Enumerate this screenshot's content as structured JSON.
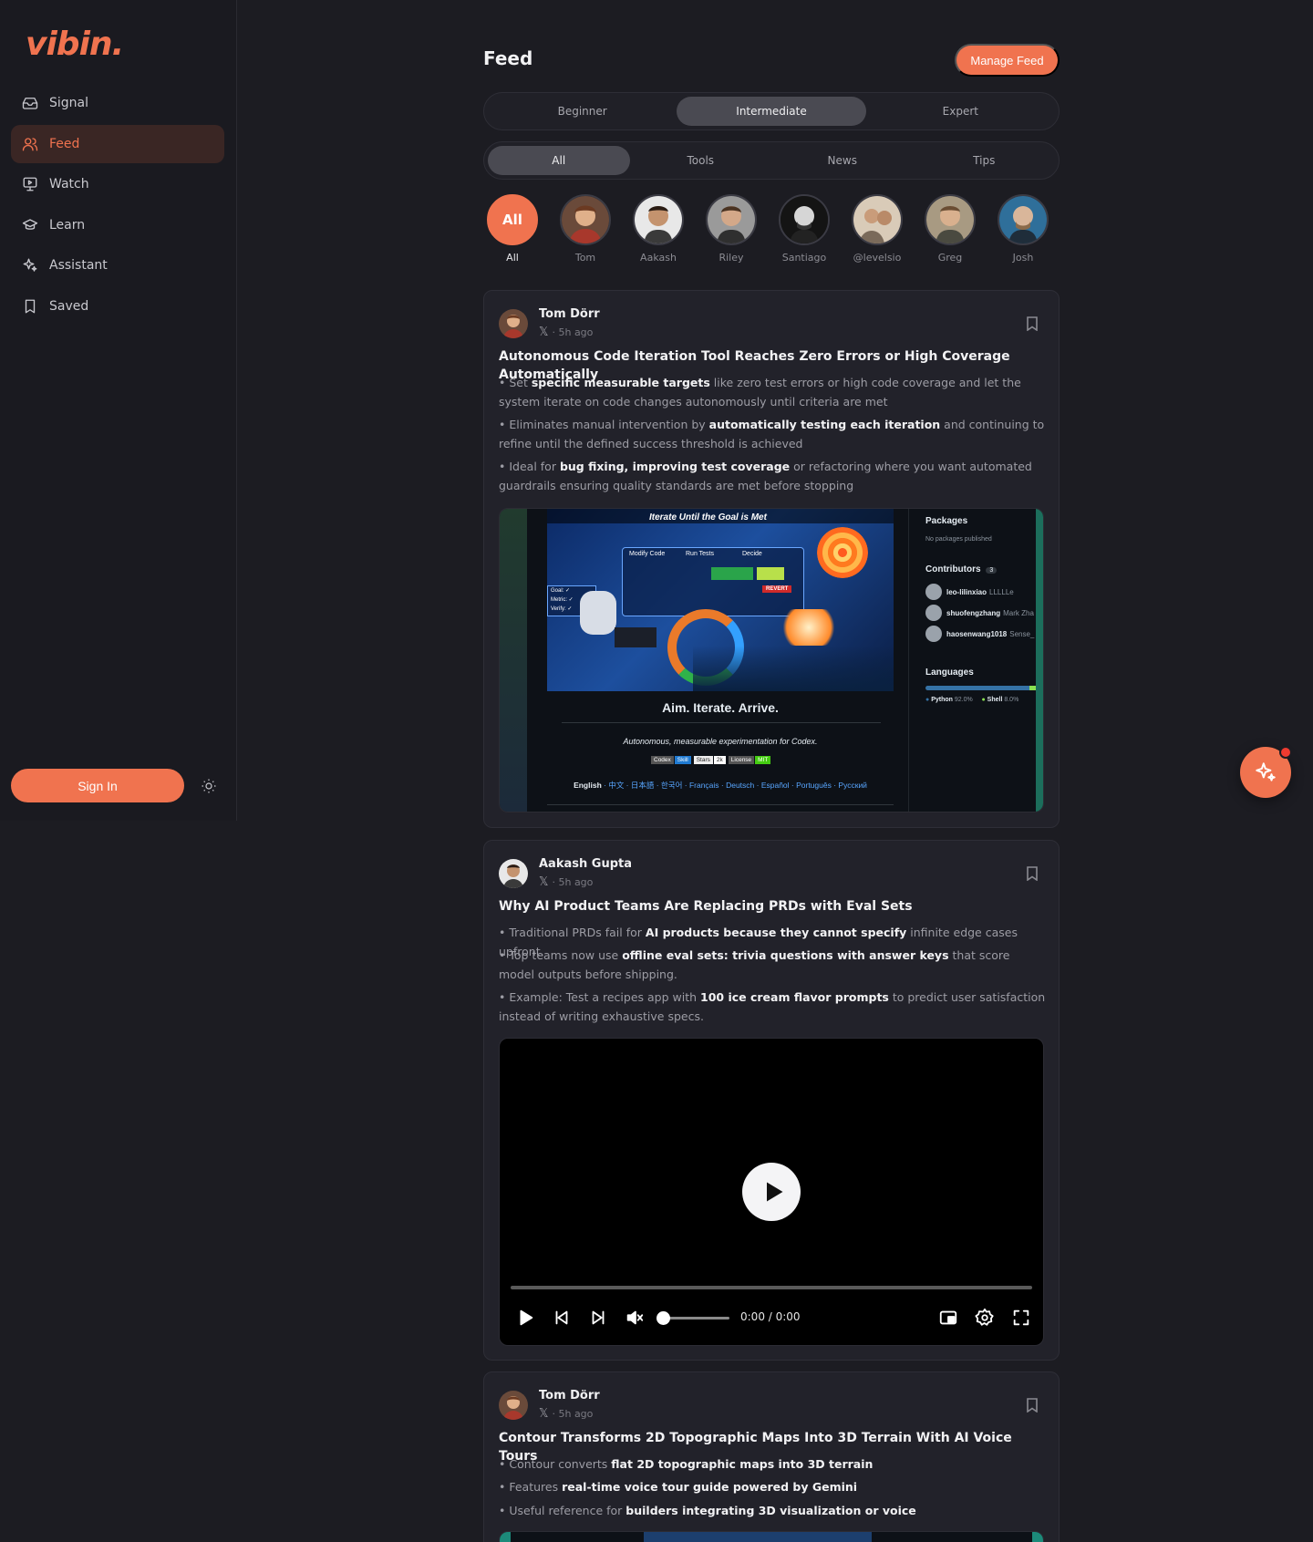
{
  "app": {
    "logo": "vibin."
  },
  "sidebar": {
    "items": [
      {
        "label": "Signal",
        "icon": "inbox-icon"
      },
      {
        "label": "Feed",
        "icon": "users-icon",
        "active": true
      },
      {
        "label": "Watch",
        "icon": "monitor-play-icon"
      },
      {
        "label": "Learn",
        "icon": "graduation-cap-icon"
      },
      {
        "label": "Assistant",
        "icon": "sparkles-icon"
      },
      {
        "label": "Saved",
        "icon": "bookmark-icon"
      }
    ],
    "signin_label": "Sign In",
    "theme_icon": "sun-icon"
  },
  "header": {
    "title": "Feed",
    "manage_label": "Manage Feed"
  },
  "levels": {
    "options": [
      "Beginner",
      "Intermediate",
      "Expert"
    ],
    "selected": "Intermediate"
  },
  "categories": {
    "options": [
      "All",
      "Tools",
      "News",
      "Tips"
    ],
    "selected": "All"
  },
  "authors": [
    {
      "badge": "All",
      "label": "All",
      "active": true
    },
    {
      "label": "Tom"
    },
    {
      "label": "Aakash"
    },
    {
      "label": "Riley"
    },
    {
      "label": "Santiago"
    },
    {
      "label": "@levelsio"
    },
    {
      "label": "Greg"
    },
    {
      "label": "Josh"
    }
  ],
  "posts": [
    {
      "author": "Tom Dörr",
      "source_icon": "x-icon",
      "meta": "· 5h ago",
      "title": "Autonomous Code Iteration Tool Reaches Zero Errors or High Coverage Automatically",
      "bullets": [
        {
          "pre": "• Set ",
          "bold": "specific measurable targets",
          "post": " like zero test errors or high code coverage and let the system iterate on code changes autonomously until criteria are met"
        },
        {
          "pre": "• Eliminates manual intervention by ",
          "bold": "automatically testing each iteration",
          "post": " and continuing to refine until the defined success threshold is achieved"
        },
        {
          "pre": "• Ideal for ",
          "bold": "bug fixing, improving test coverage",
          "post": " or refactoring where you want automated guardrails ensuring quality standards are met before stopping"
        }
      ],
      "media": {
        "banner_title": "Iterate Until the Goal is Met",
        "banner_boxes": [
          "Modify Code",
          "Run Tests",
          "Decide"
        ],
        "banner_side": [
          "Goal: ✓",
          "Metric: ✓",
          "Verify: ✓"
        ],
        "revert": "REVERT",
        "tagline": "Aim. Iterate. Arrive.",
        "subtitle": "Autonomous, measurable experimentation for Codex.",
        "badges": [
          "Codex",
          "Skill",
          "Stars",
          "2k",
          "License",
          "MIT"
        ],
        "languages_line_lead": "English",
        "languages_line": " · 中文 · 日本語 · 한국어 · Français · Deutsch · Español · Português · Русский",
        "side_packages": "Packages",
        "side_packages_note": "No packages published",
        "side_contributors": "Contributors",
        "side_contributors_count": "3",
        "contributors": [
          {
            "name": "leo-lilinxiao",
            "tag": "LLLLLe"
          },
          {
            "name": "shuofengzhang",
            "tag": "Mark Zha"
          },
          {
            "name": "haosenwang1018",
            "tag": "Sense_"
          }
        ],
        "side_languages": "Languages",
        "lang_1": "Python",
        "lang_1_pct": "92.0%",
        "lang_2": "Shell",
        "lang_2_pct": "8.0%"
      }
    },
    {
      "author": "Aakash Gupta",
      "source_icon": "x-icon",
      "meta": "· 5h ago",
      "title": "Why AI Product Teams Are Replacing PRDs with Eval Sets",
      "bullets": [
        {
          "pre": "• Traditional PRDs fail for ",
          "bold": "AI products because they cannot specify",
          "post": " infinite edge cases upfront."
        },
        {
          "pre": "• Top teams now use ",
          "bold": "offline eval sets: trivia questions with answer keys",
          "post": " that score model outputs before shipping."
        },
        {
          "pre": "• Example: Test a recipes app with ",
          "bold": "100 ice cream flavor prompts",
          "post": " to predict user satisfaction instead of writing exhaustive specs."
        }
      ],
      "video": {
        "time": "0:00 / 0:00",
        "progress": 0
      }
    },
    {
      "author": "Tom Dörr",
      "source_icon": "x-icon",
      "meta": "· 5h ago",
      "title": "Contour Transforms 2D Topographic Maps Into 3D Terrain With AI Voice Tours",
      "bullets": [
        {
          "pre": "• Contour converts ",
          "bold": "flat 2D topographic maps into 3D terrain",
          "post": ""
        },
        {
          "pre": "• Features ",
          "bold": "real-time voice tour guide powered by Gemini",
          "post": ""
        },
        {
          "pre": "• Useful reference for ",
          "bold": "builders integrating 3D visualization or voice",
          "post": ""
        }
      ]
    }
  ],
  "assistant_fab": {
    "icon": "sparkles-icon",
    "notification": true
  },
  "colors": {
    "accent": "#f0734f",
    "background": "#1c1c22",
    "card": "#22222a",
    "sidebar": "#1a1a20"
  }
}
